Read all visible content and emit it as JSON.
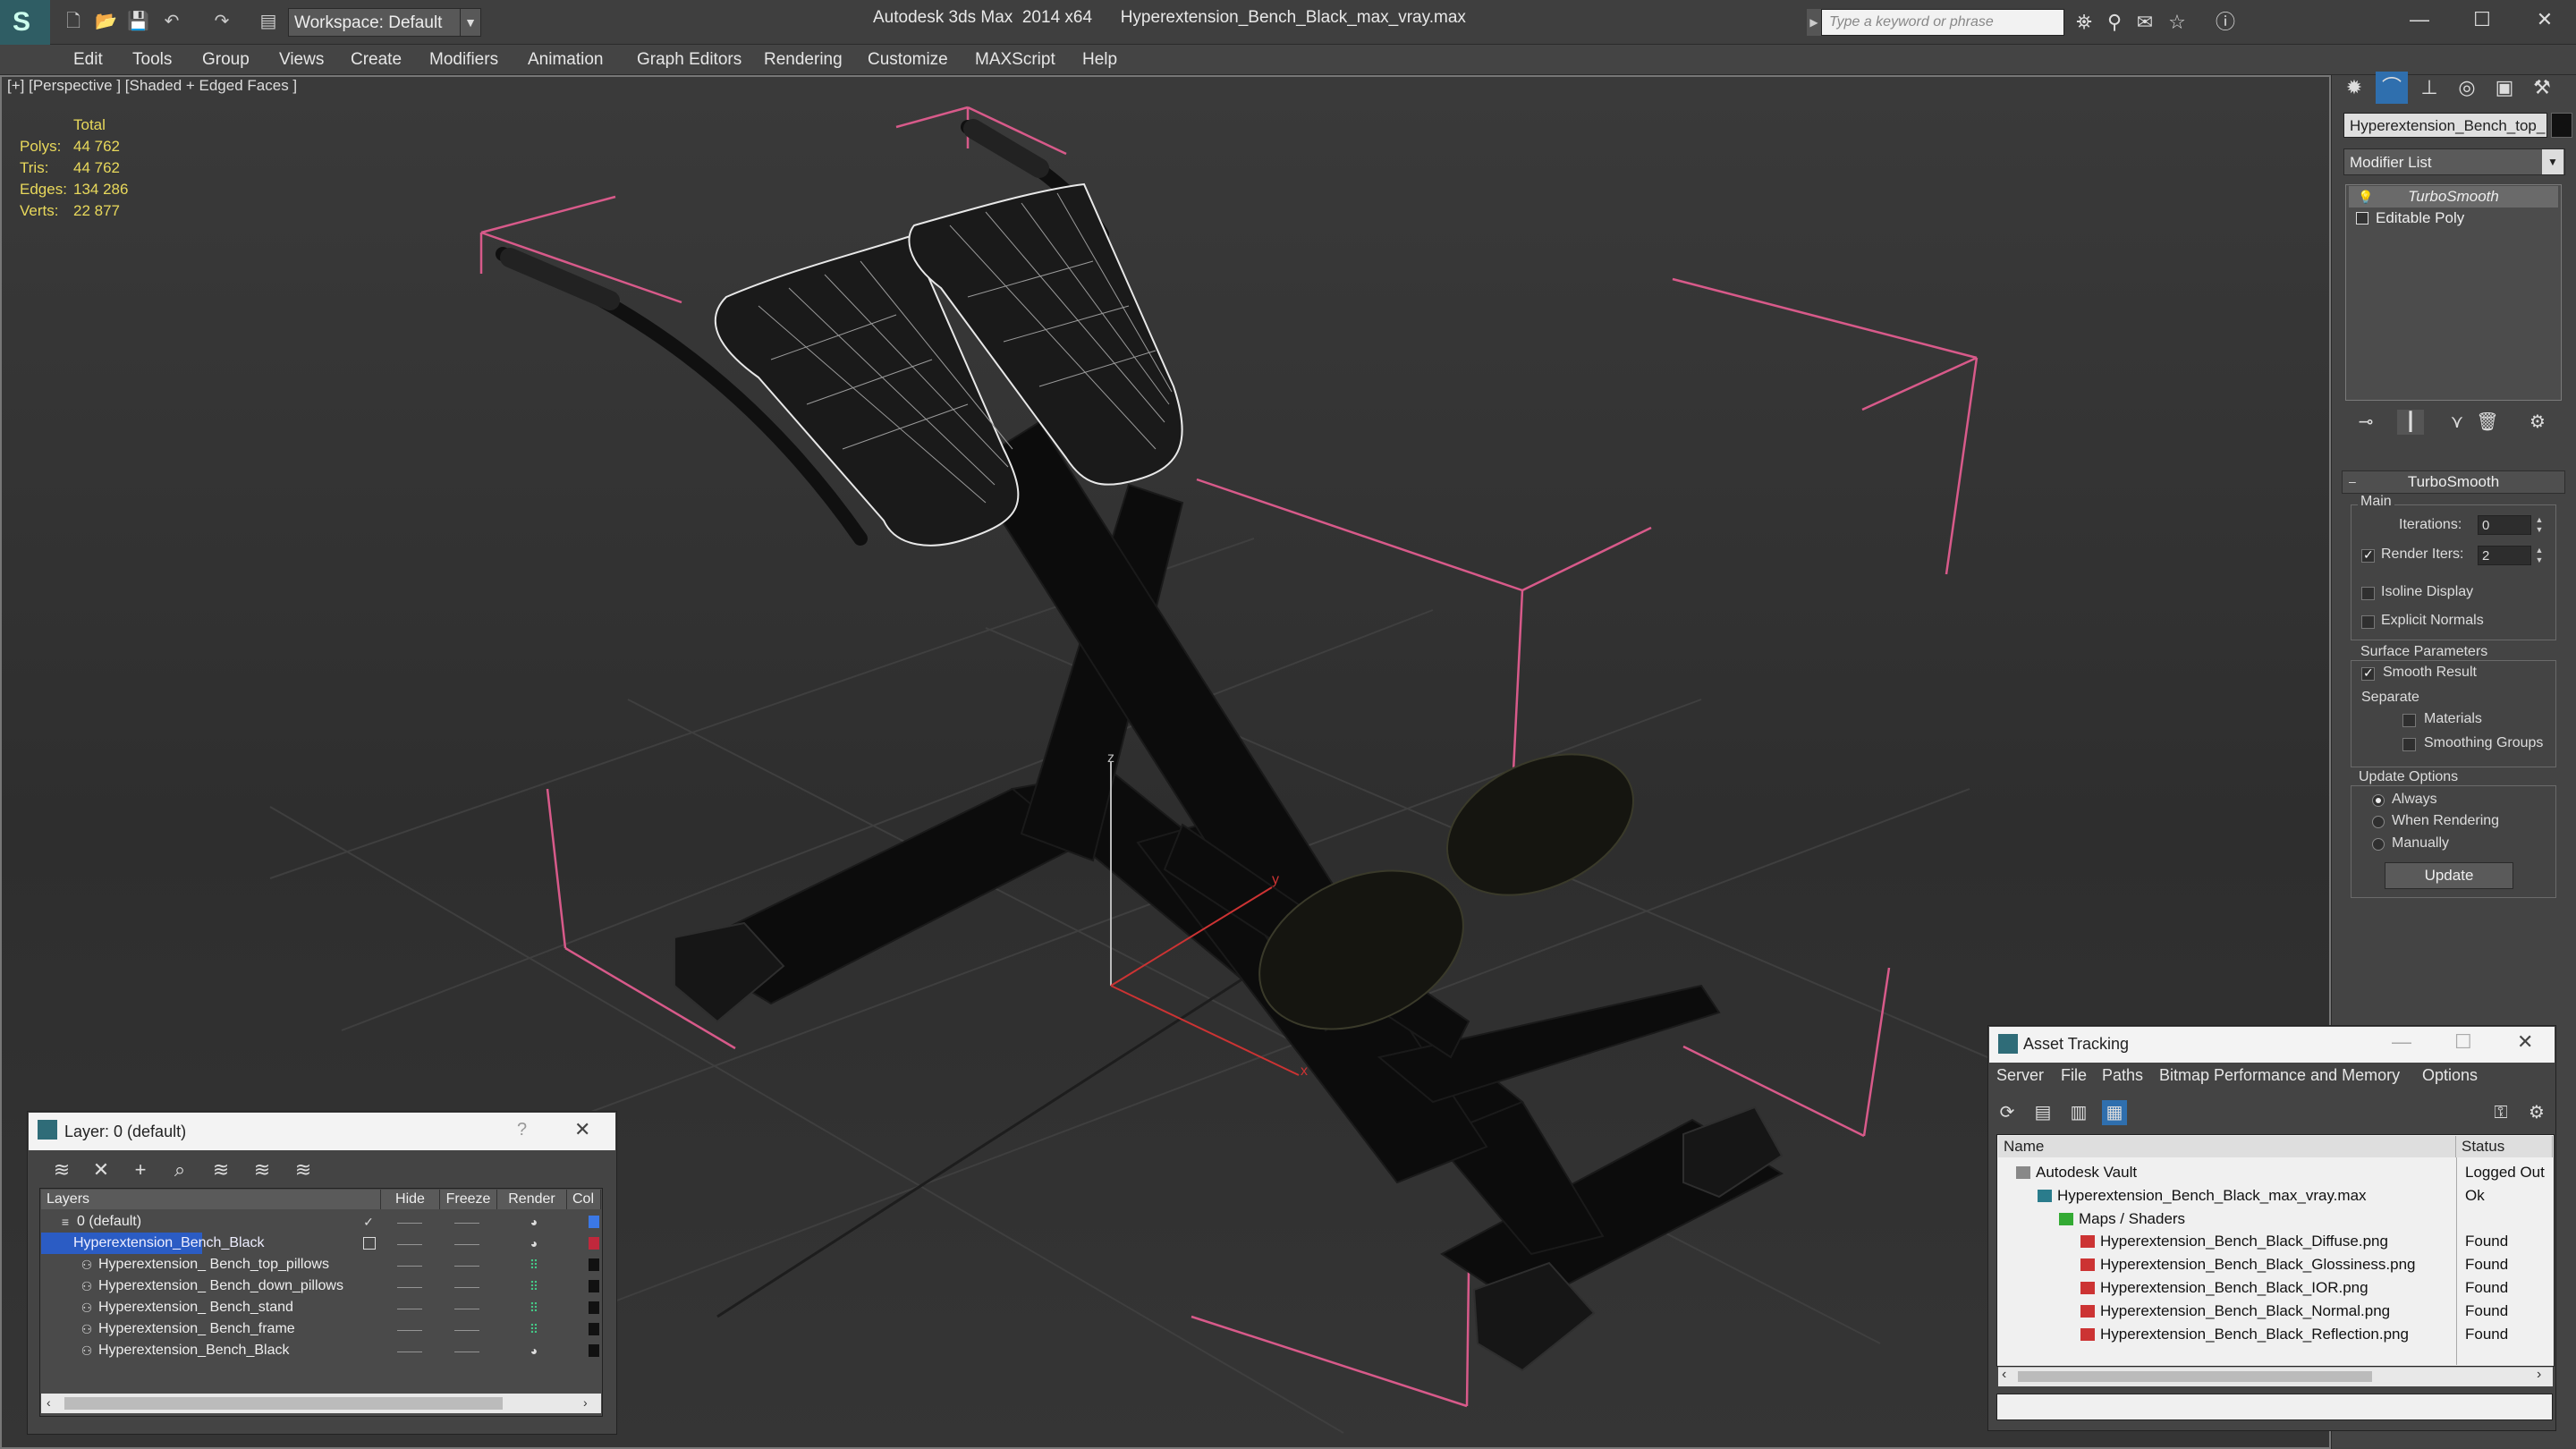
{
  "app": {
    "title_text": "Autodesk 3ds Max  2014 x64      Hyperextension_Bench_Black_max_vray.max",
    "workspace": "Workspace: Default",
    "search_placeholder": "Type a keyword or phrase"
  },
  "menu": [
    "Edit",
    "Tools",
    "Group",
    "Views",
    "Create",
    "Modifiers",
    "Animation",
    "Graph Editors",
    "Rendering",
    "Customize",
    "MAXScript",
    "Help"
  ],
  "viewport": {
    "label": "[+] [Perspective ] [Shaded + Edged Faces ]",
    "stats": {
      "header": "Total",
      "polys_label": "Polys:",
      "polys": "44 762",
      "tris_label": "Tris:",
      "tris": "44 762",
      "edges_label": "Edges:",
      "edges": "134 286",
      "verts_label": "Verts:",
      "verts": "22 877"
    },
    "axis_labels": {
      "z": "z",
      "y": "y",
      "x": "x"
    }
  },
  "command_panel": {
    "object_name": "Hyperextension_Bench_top_",
    "modifier_list": "Modifier List",
    "stack": [
      "TurboSmooth",
      "Editable Poly"
    ],
    "turbosmooth": {
      "header": "TurboSmooth",
      "main_label": "Main",
      "iterations_label": "Iterations:",
      "iterations": "0",
      "render_iters_label": "Render Iters:",
      "render_iters": "2",
      "render_iters_checked": true,
      "isoline_label": "Isoline Display",
      "isoline_checked": false,
      "explicit_label": "Explicit Normals",
      "explicit_checked": false,
      "surface_label": "Surface Parameters",
      "smooth_result_label": "Smooth Result",
      "smooth_result_checked": true,
      "separate_label": "Separate",
      "materials_label": "Materials",
      "materials_checked": false,
      "smoothing_groups_label": "Smoothing Groups",
      "smoothing_groups_checked": false,
      "update_options_label": "Update Options",
      "always_label": "Always",
      "when_rendering_label": "When Rendering",
      "manually_label": "Manually",
      "update_mode": "Always",
      "update_button": "Update"
    }
  },
  "layer_dialog": {
    "title": "Layer: 0 (default)",
    "help": "?",
    "columns": [
      "Layers",
      "Hide",
      "Freeze",
      "Render",
      "Col"
    ],
    "rows": [
      {
        "name": "0 (default)",
        "indent": 1,
        "color": "#3b78e6",
        "selected": false,
        "current": true
      },
      {
        "name": "Hyperextension_Bench_Black",
        "indent": 1,
        "color": "#c0283c",
        "selected": true,
        "current": false
      },
      {
        "name": "Hyperextension_ Bench_top_pillows",
        "indent": 2,
        "color": "#111111",
        "selected": false,
        "current": false
      },
      {
        "name": "Hyperextension_ Bench_down_pillows",
        "indent": 2,
        "color": "#111111",
        "selected": false,
        "current": false
      },
      {
        "name": "Hyperextension_ Bench_stand",
        "indent": 2,
        "color": "#111111",
        "selected": false,
        "current": false
      },
      {
        "name": "Hyperextension_ Bench_frame",
        "indent": 2,
        "color": "#111111",
        "selected": false,
        "current": false
      },
      {
        "name": "Hyperextension_Bench_Black",
        "indent": 2,
        "color": "#111111",
        "selected": false,
        "current": false
      }
    ]
  },
  "asset_dialog": {
    "title": "Asset Tracking",
    "menu": [
      "Server",
      "File",
      "Paths",
      "Bitmap Performance and Memory",
      "Options"
    ],
    "columns": [
      "Name",
      "Status"
    ],
    "rows": [
      {
        "name": "Autodesk Vault",
        "status": "Logged Out",
        "indent": 0,
        "icon": "vault-icon"
      },
      {
        "name": "Hyperextension_Bench_Black_max_vray.max",
        "status": "Ok",
        "indent": 1,
        "icon": "max-file-icon"
      },
      {
        "name": "Maps / Shaders",
        "status": "",
        "indent": 2,
        "icon": "maps-folder-icon"
      },
      {
        "name": "Hyperextension_Bench_Black_Diffuse.png",
        "status": "Found",
        "indent": 3,
        "icon": "png-icon"
      },
      {
        "name": "Hyperextension_Bench_Black_Glossiness.png",
        "status": "Found",
        "indent": 3,
        "icon": "png-icon"
      },
      {
        "name": "Hyperextension_Bench_Black_IOR.png",
        "status": "Found",
        "indent": 3,
        "icon": "png-icon"
      },
      {
        "name": "Hyperextension_Bench_Black_Normal.png",
        "status": "Found",
        "indent": 3,
        "icon": "png-icon"
      },
      {
        "name": "Hyperextension_Bench_Black_Reflection.png",
        "status": "Found",
        "indent": 3,
        "icon": "png-icon"
      }
    ]
  },
  "colors": {
    "stats_text": "#e8d85b",
    "bbox_lines": "#d85a8a",
    "selection": "#2b5cc4"
  }
}
